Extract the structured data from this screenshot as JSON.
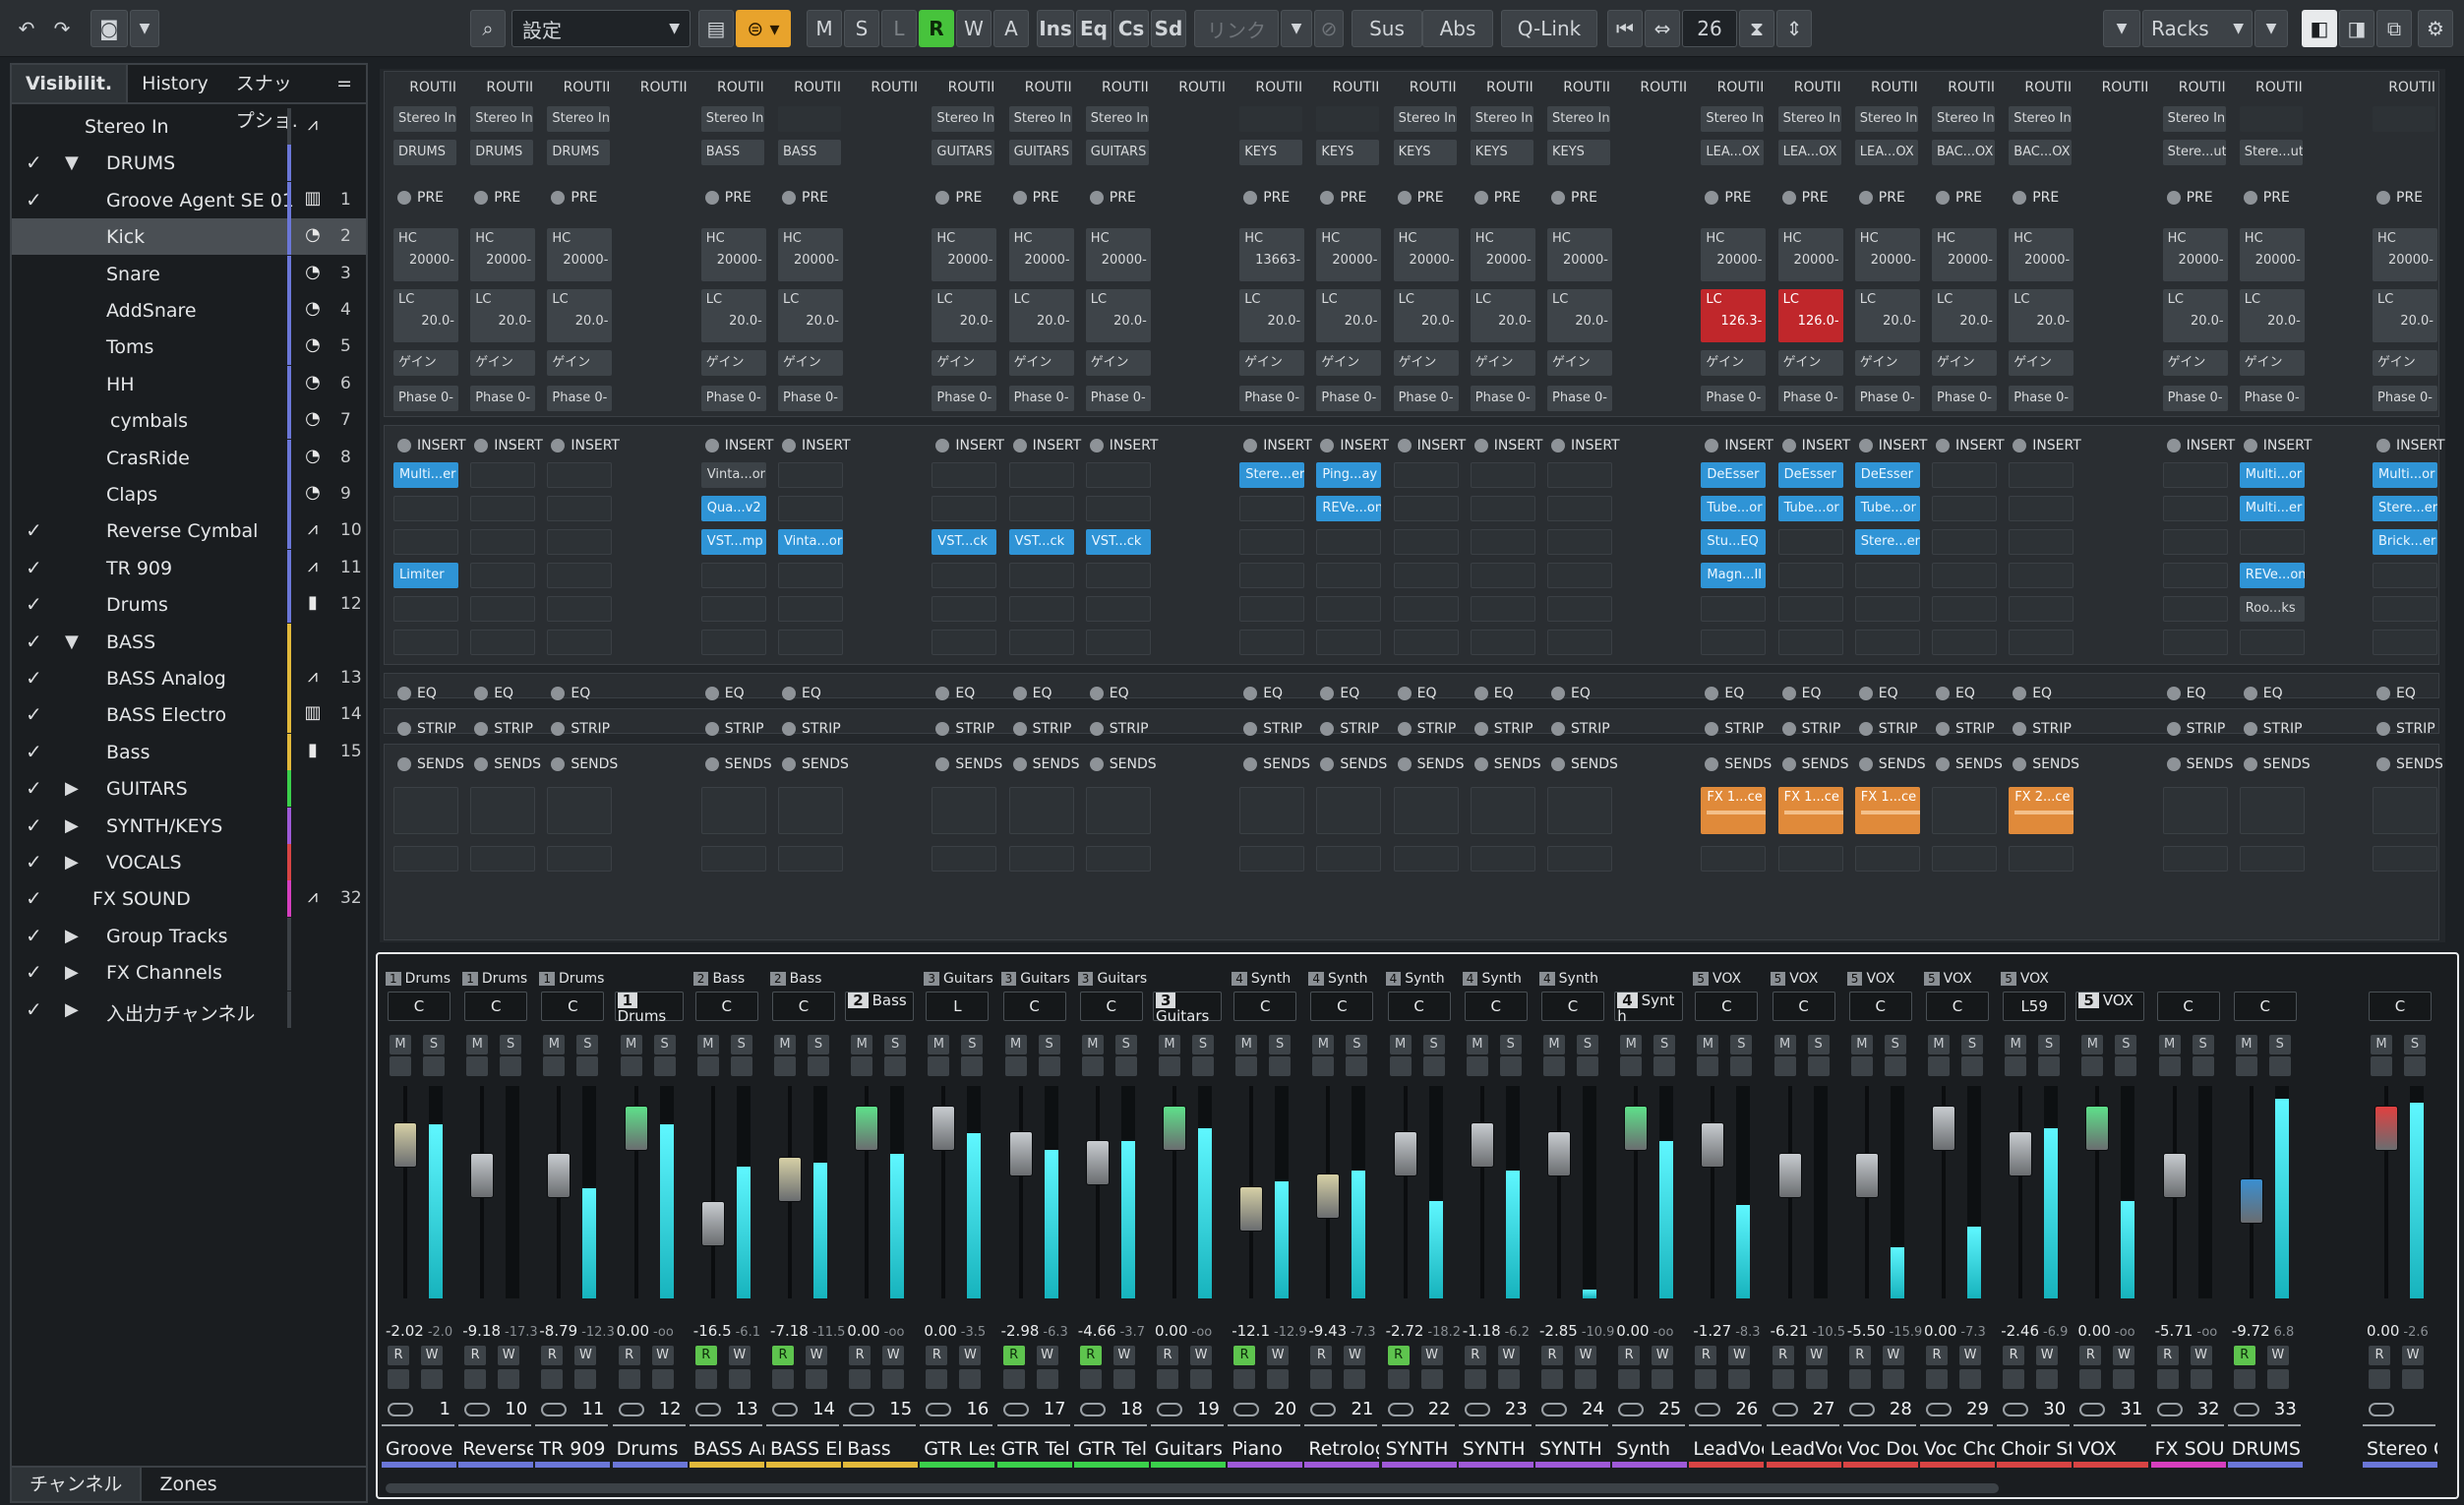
{
  "toolbar": {
    "preset_label": "設定",
    "btn_m": "M",
    "btn_s": "S",
    "btn_l": "L",
    "btn_r": "R",
    "btn_w": "W",
    "btn_a": "A",
    "btn_ins": "Ins",
    "btn_eq": "Eq",
    "btn_cs": "Cs",
    "btn_sd": "Sd",
    "link_label": "リンク",
    "sus": "Sus",
    "abs": "Abs",
    "qlink": "Q-Link",
    "channel_count": "26",
    "racks": "Racks"
  },
  "left": {
    "tabs": [
      "Visibilit.",
      "History",
      "スナップショ.",
      "="
    ],
    "bottom_tabs": [
      "チャンネル",
      "Zones"
    ],
    "tracks": [
      {
        "check": "",
        "arrow": "",
        "name": "Stereo In",
        "indent": 74,
        "icon": "waveform-icon",
        "glyph": "⩘",
        "num": "",
        "bar": "",
        "sel": false
      },
      {
        "check": "✓",
        "arrow": "▼",
        "name": "DRUMS",
        "indent": 96,
        "icon": "",
        "glyph": "",
        "num": "",
        "bar": "#6b77d8",
        "sel": false
      },
      {
        "check": "✓",
        "arrow": "",
        "name": "Groove Agent SE 01",
        "indent": 96,
        "icon": "keyboard-icon",
        "glyph": "▥",
        "num": "1",
        "bar": "#6b77d8",
        "sel": false
      },
      {
        "check": "",
        "arrow": "",
        "name": "Kick",
        "indent": 96,
        "icon": "knob-icon",
        "glyph": "◔",
        "num": "2",
        "bar": "#6b77d8",
        "sel": true
      },
      {
        "check": "",
        "arrow": "",
        "name": "Snare",
        "indent": 96,
        "icon": "knob-icon",
        "glyph": "◔",
        "num": "3",
        "bar": "#6b77d8",
        "sel": false
      },
      {
        "check": "",
        "arrow": "",
        "name": "AddSnare",
        "indent": 96,
        "icon": "knob-icon",
        "glyph": "◔",
        "num": "4",
        "bar": "#6b77d8",
        "sel": false
      },
      {
        "check": "",
        "arrow": "",
        "name": "Toms",
        "indent": 96,
        "icon": "knob-icon",
        "glyph": "◔",
        "num": "5",
        "bar": "#6b77d8",
        "sel": false
      },
      {
        "check": "",
        "arrow": "",
        "name": "HH",
        "indent": 96,
        "icon": "knob-icon",
        "glyph": "◔",
        "num": "6",
        "bar": "#6b77d8",
        "sel": false
      },
      {
        "check": "",
        "arrow": "",
        "name": "cymbals",
        "indent": 100,
        "icon": "knob-icon",
        "glyph": "◔",
        "num": "7",
        "bar": "#6b77d8",
        "sel": false
      },
      {
        "check": "",
        "arrow": "",
        "name": "CrasRide",
        "indent": 96,
        "icon": "knob-icon",
        "glyph": "◔",
        "num": "8",
        "bar": "#6b77d8",
        "sel": false
      },
      {
        "check": "",
        "arrow": "",
        "name": "Claps",
        "indent": 96,
        "icon": "knob-icon",
        "glyph": "◔",
        "num": "9",
        "bar": "#6b77d8",
        "sel": false
      },
      {
        "check": "✓",
        "arrow": "",
        "name": "Reverse Cymbal",
        "indent": 96,
        "icon": "waveform-icon",
        "glyph": "⩘",
        "num": "10",
        "bar": "#6b77d8",
        "sel": false
      },
      {
        "check": "✓",
        "arrow": "",
        "name": "TR 909",
        "indent": 96,
        "icon": "waveform-icon",
        "glyph": "⩘",
        "num": "11",
        "bar": "#6b77d8",
        "sel": false
      },
      {
        "check": "✓",
        "arrow": "",
        "name": "Drums",
        "indent": 96,
        "icon": "group-icon",
        "glyph": "▮",
        "num": "12",
        "bar": "#6b77d8",
        "sel": false
      },
      {
        "check": "✓",
        "arrow": "▼",
        "name": "BASS",
        "indent": 96,
        "icon": "",
        "glyph": "",
        "num": "",
        "bar": "#e2b93b",
        "sel": false
      },
      {
        "check": "✓",
        "arrow": "",
        "name": "BASS Analog",
        "indent": 96,
        "icon": "waveform-icon",
        "glyph": "⩘",
        "num": "13",
        "bar": "#e2b93b",
        "sel": false
      },
      {
        "check": "✓",
        "arrow": "",
        "name": "BASS Electro",
        "indent": 96,
        "icon": "keyboard-icon",
        "glyph": "▥",
        "num": "14",
        "bar": "#e2b93b",
        "sel": false
      },
      {
        "check": "✓",
        "arrow": "",
        "name": "Bass",
        "indent": 96,
        "icon": "group-icon",
        "glyph": "▮",
        "num": "15",
        "bar": "#e2b93b",
        "sel": false
      },
      {
        "check": "✓",
        "arrow": "▶",
        "name": "GUITARS",
        "indent": 96,
        "icon": "",
        "glyph": "",
        "num": "",
        "bar": "#3bd04b",
        "sel": false
      },
      {
        "check": "✓",
        "arrow": "▶",
        "name": "SYNTH/KEYS",
        "indent": 96,
        "icon": "",
        "glyph": "",
        "num": "",
        "bar": "#9f5ad8",
        "sel": false
      },
      {
        "check": "✓",
        "arrow": "▶",
        "name": "VOCALS",
        "indent": 96,
        "icon": "",
        "glyph": "",
        "num": "",
        "bar": "#d84444",
        "sel": false
      },
      {
        "check": "✓",
        "arrow": "",
        "name": "FX SOUND",
        "indent": 82,
        "icon": "waveform-icon",
        "glyph": "⩘",
        "num": "32",
        "bar": "#d63fbf",
        "sel": false
      },
      {
        "check": "✓",
        "arrow": "▶",
        "name": "Group Tracks",
        "indent": 96,
        "icon": "",
        "glyph": "",
        "num": "",
        "bar": "",
        "sel": false
      },
      {
        "check": "✓",
        "arrow": "▶",
        "name": "FX Channels",
        "indent": 96,
        "icon": "",
        "glyph": "",
        "num": "",
        "bar": "",
        "sel": false
      },
      {
        "check": "✓",
        "arrow": "▶",
        "name": "入出力チャンネル",
        "indent": 96,
        "icon": "",
        "glyph": "",
        "num": "",
        "bar": "",
        "sel": false
      }
    ]
  },
  "rack": {
    "routing_label": "ROUTII",
    "pre_label": "PRE",
    "insert_label": "INSERT",
    "eq_label": "EQ",
    "strip_label": "STRIP",
    "sends_label": "SENDS",
    "gain_label": "ゲイン",
    "phase_label": "Phase 0-",
    "hc_label": "HC",
    "lc_label": "LC"
  },
  "channels": [
    {
      "name": "Groove",
      "num": "1",
      "group": "Drums",
      "gnum": "1",
      "color": "#6b77d8",
      "in": "Stereo In",
      "out": "DRUMS",
      "hc": "20000-",
      "lc": "20.0-",
      "lcon": false,
      "ins": [
        "b:Multi...er",
        "",
        "",
        "b:Limiter",
        "",
        ""
      ],
      "send": "",
      "pan": "C",
      "db": "-2.02",
      "db2": "-2.0",
      "fader": 0.72,
      "meter": 0.82,
      "fcol": "#d6d0a6",
      "r": false,
      "w": false
    },
    {
      "name": "Reverse",
      "num": "10",
      "group": "Drums",
      "gnum": "1",
      "color": "#6b77d8",
      "in": "Stereo In",
      "out": "DRUMS",
      "hc": "20000-",
      "lc": "20.0-",
      "lcon": false,
      "ins": [
        "",
        "",
        "",
        "",
        "",
        ""
      ],
      "send": "",
      "pan": "C",
      "db": "-9.18",
      "db2": "-17.3",
      "fader": 0.58,
      "meter": 0.0,
      "fcol": "#c8ccd0",
      "r": false,
      "w": false
    },
    {
      "name": "TR 909",
      "num": "11",
      "group": "Drums",
      "gnum": "1",
      "color": "#6b77d8",
      "in": "Stereo In",
      "out": "DRUMS",
      "hc": "20000-",
      "lc": "20.0-",
      "lcon": false,
      "ins": [
        "",
        "",
        "",
        "",
        "",
        ""
      ],
      "send": "",
      "pan": "C",
      "db": "-8.79",
      "db2": "-12.3",
      "fader": 0.58,
      "meter": 0.52,
      "fcol": "#c8ccd0",
      "r": false,
      "w": false
    },
    {
      "name": "Drums",
      "num": "12",
      "group": "",
      "gnum": "1",
      "grpname": "Drums",
      "color": "#6b77d8",
      "in": "",
      "out": "",
      "hc": "",
      "lc": "",
      "lcon": false,
      "ins": null,
      "send": "",
      "pan": "",
      "db": "0.00",
      "db2": "-oo",
      "fader": 0.8,
      "meter": 0.82,
      "fcol": "#5ee08a",
      "r": false,
      "w": false,
      "isgroup": true
    },
    {
      "name": "BASS Ar",
      "num": "13",
      "group": "Bass",
      "gnum": "2",
      "color": "#e2b93b",
      "in": "Stereo In",
      "out": "BASS",
      "hc": "20000-",
      "lc": "20.0-",
      "lcon": false,
      "ins": [
        "g:Vinta...or",
        "b:Qua...v2",
        "b:VST...mp",
        "",
        "",
        ""
      ],
      "send": "",
      "pan": "C",
      "db": "-16.5",
      "db2": "-6.1",
      "fader": 0.35,
      "meter": 0.62,
      "fcol": "#c8ccd0",
      "r": true,
      "w": false
    },
    {
      "name": "BASS El",
      "num": "14",
      "group": "Bass",
      "gnum": "2",
      "color": "#e2b93b",
      "in": "",
      "out": "BASS",
      "hc": "20000-",
      "lc": "20.0-",
      "lcon": false,
      "ins": [
        "",
        "",
        "b:Vinta...or",
        "",
        "",
        ""
      ],
      "send": "",
      "pan": "C",
      "db": "-7.18",
      "db2": "-11.5",
      "fader": 0.56,
      "meter": 0.64,
      "fcol": "#d6d0a6",
      "r": true,
      "w": false
    },
    {
      "name": "Bass",
      "num": "15",
      "group": "",
      "gnum": "2",
      "grpname": "Bass",
      "color": "#e2b93b",
      "in": "",
      "out": "",
      "hc": "",
      "lc": "",
      "lcon": false,
      "ins": null,
      "send": "",
      "pan": "",
      "db": "0.00",
      "db2": "-oo",
      "fader": 0.8,
      "meter": 0.68,
      "fcol": "#5ee08a",
      "r": false,
      "w": false,
      "isgroup": true
    },
    {
      "name": "GTR Les",
      "num": "16",
      "group": "Guitars",
      "gnum": "3",
      "color": "#3bd04b",
      "in": "Stereo In",
      "out": "GUITARS",
      "hc": "20000-",
      "lc": "20.0-",
      "lcon": false,
      "ins": [
        "",
        "",
        "b:VST...ck",
        "",
        "",
        ""
      ],
      "send": "",
      "pan": "L",
      "db": "0.00",
      "db2": "-3.5",
      "fader": 0.8,
      "meter": 0.78,
      "fcol": "#c8ccd0",
      "r": false,
      "w": false
    },
    {
      "name": "GTR Tel",
      "num": "17",
      "group": "Guitars",
      "gnum": "3",
      "color": "#3bd04b",
      "in": "Stereo In",
      "out": "GUITARS",
      "hc": "20000-",
      "lc": "20.0-",
      "lcon": false,
      "ins": [
        "",
        "",
        "b:VST...ck",
        "",
        "",
        ""
      ],
      "send": "",
      "pan": "C",
      "db": "-2.98",
      "db2": "-6.3",
      "fader": 0.68,
      "meter": 0.7,
      "fcol": "#c8ccd0",
      "r": true,
      "w": false
    },
    {
      "name": "GTR Tel",
      "num": "18",
      "group": "Guitars",
      "gnum": "3",
      "color": "#3bd04b",
      "in": "Stereo In",
      "out": "GUITARS",
      "hc": "20000-",
      "lc": "20.0-",
      "lcon": false,
      "ins": [
        "",
        "",
        "b:VST...ck",
        "",
        "",
        ""
      ],
      "send": "",
      "pan": "C",
      "db": "-4.66",
      "db2": "-3.7",
      "fader": 0.64,
      "meter": 0.74,
      "fcol": "#c8ccd0",
      "r": true,
      "w": false
    },
    {
      "name": "Guitars",
      "num": "19",
      "group": "",
      "gnum": "3",
      "grpname": "Guitars",
      "color": "#3bd04b",
      "in": "",
      "out": "",
      "hc": "",
      "lc": "",
      "lcon": false,
      "ins": null,
      "send": "",
      "pan": "",
      "db": "0.00",
      "db2": "-oo",
      "fader": 0.8,
      "meter": 0.8,
      "fcol": "#5ee08a",
      "r": false,
      "w": false,
      "isgroup": true
    },
    {
      "name": "Piano",
      "num": "20",
      "group": "Synth",
      "gnum": "4",
      "color": "#9f5ad8",
      "in": "",
      "out": "KEYS",
      "hc": "13663-",
      "lc": "20.0-",
      "lcon": false,
      "ins": [
        "b:Stere...er",
        "",
        "",
        "",
        "",
        ""
      ],
      "send": "",
      "pan": "C",
      "db": "-12.1",
      "db2": "-12.9",
      "fader": 0.42,
      "meter": 0.55,
      "fcol": "#d6d0a6",
      "r": true,
      "w": false
    },
    {
      "name": "Retrolog",
      "num": "21",
      "group": "Synth",
      "gnum": "4",
      "color": "#9f5ad8",
      "in": "",
      "out": "KEYS",
      "hc": "20000-",
      "lc": "20.0-",
      "lcon": false,
      "ins": [
        "b:Ping...ay",
        "b:REVe...on",
        "",
        "",
        "",
        ""
      ],
      "send": "",
      "pan": "C",
      "db": "-9.43",
      "db2": "-7.3",
      "fader": 0.48,
      "meter": 0.6,
      "fcol": "#d6d0a6",
      "r": false,
      "w": false
    },
    {
      "name": "SYNTH",
      "num": "22",
      "group": "Synth",
      "gnum": "4",
      "color": "#9f5ad8",
      "in": "Stereo In",
      "out": "KEYS",
      "hc": "20000-",
      "lc": "20.0-",
      "lcon": false,
      "ins": [
        "",
        "",
        "",
        "",
        "",
        ""
      ],
      "send": "",
      "pan": "C",
      "db": "-2.72",
      "db2": "-18.2",
      "fader": 0.68,
      "meter": 0.46,
      "fcol": "#c8ccd0",
      "r": true,
      "w": false
    },
    {
      "name": "SYNTH",
      "num": "23",
      "group": "Synth",
      "gnum": "4",
      "color": "#9f5ad8",
      "in": "Stereo In",
      "out": "KEYS",
      "hc": "20000-",
      "lc": "20.0-",
      "lcon": false,
      "ins": [
        "",
        "",
        "",
        "",
        "",
        ""
      ],
      "send": "",
      "pan": "C",
      "db": "-1.18",
      "db2": "-6.2",
      "fader": 0.72,
      "meter": 0.6,
      "fcol": "#c8ccd0",
      "r": false,
      "w": false
    },
    {
      "name": "SYNTH",
      "num": "24",
      "group": "Synth",
      "gnum": "4",
      "color": "#9f5ad8",
      "in": "Stereo In",
      "out": "KEYS",
      "hc": "20000-",
      "lc": "20.0-",
      "lcon": false,
      "ins": [
        "",
        "",
        "",
        "",
        "",
        ""
      ],
      "send": "",
      "pan": "C",
      "db": "-2.85",
      "db2": "-10.9",
      "fader": 0.68,
      "meter": 0.04,
      "fcol": "#c8ccd0",
      "r": false,
      "w": false
    },
    {
      "name": "Synth",
      "num": "25",
      "group": "",
      "gnum": "4",
      "grpname": "Synt h",
      "color": "#9f5ad8",
      "in": "",
      "out": "",
      "hc": "",
      "lc": "",
      "lcon": false,
      "ins": null,
      "send": "",
      "pan": "",
      "db": "0.00",
      "db2": "-oo",
      "fader": 0.8,
      "meter": 0.74,
      "fcol": "#5ee08a",
      "r": false,
      "w": false,
      "isgroup": true
    },
    {
      "name": "LeadVoc",
      "num": "26",
      "group": "VOX",
      "gnum": "5",
      "color": "#d84444",
      "in": "Stereo In",
      "out": "LEA...OX",
      "hc": "20000-",
      "lc": "126.3-",
      "lcon": true,
      "ins": [
        "b:DeEsser",
        "b:Tube...or",
        "b:Stu...EQ",
        "b:Magn...II",
        "",
        ""
      ],
      "send": "FX 1...ce",
      "pan": "C",
      "db": "-1.27",
      "db2": "-8.3",
      "fader": 0.72,
      "meter": 0.44,
      "fcol": "#c8ccd0",
      "r": false,
      "w": false
    },
    {
      "name": "LeadVoc",
      "num": "27",
      "group": "VOX",
      "gnum": "5",
      "color": "#d84444",
      "in": "Stereo In",
      "out": "LEA...OX",
      "hc": "20000-",
      "lc": "126.0-",
      "lcon": true,
      "ins": [
        "b:DeEsser",
        "b:Tube...or",
        "",
        "",
        "",
        ""
      ],
      "send": "FX 1...ce",
      "pan": "C",
      "db": "-6.21",
      "db2": "-10.5",
      "fader": 0.58,
      "meter": 0.0,
      "fcol": "#c8ccd0",
      "r": false,
      "w": false
    },
    {
      "name": "Voc Dou",
      "num": "28",
      "group": "VOX",
      "gnum": "5",
      "color": "#d84444",
      "in": "Stereo In",
      "out": "LEA...OX",
      "hc": "20000-",
      "lc": "20.0-",
      "lcon": false,
      "ins": [
        "b:DeEsser",
        "b:Tube...or",
        "b:Stere...er",
        "",
        "",
        ""
      ],
      "send": "FX 1...ce",
      "pan": "C",
      "db": "-5.50",
      "db2": "-15.9",
      "fader": 0.58,
      "meter": 0.24,
      "fcol": "#c8ccd0",
      "r": false,
      "w": false
    },
    {
      "name": "Voc Chc",
      "num": "29",
      "group": "VOX",
      "gnum": "5",
      "color": "#d84444",
      "in": "Stereo In",
      "out": "BAC...OX",
      "hc": "20000-",
      "lc": "20.0-",
      "lcon": false,
      "ins": [
        "",
        "",
        "",
        "",
        "",
        ""
      ],
      "send": "",
      "pan": "C",
      "db": "0.00",
      "db2": "-7.3",
      "fader": 0.8,
      "meter": 0.34,
      "fcol": "#c8ccd0",
      "r": false,
      "w": false
    },
    {
      "name": "Choir St",
      "num": "30",
      "group": "VOX",
      "gnum": "5",
      "color": "#d84444",
      "in": "Stereo In",
      "out": "BAC...OX",
      "hc": "20000-",
      "lc": "20.0-",
      "lcon": false,
      "ins": [
        "",
        "",
        "",
        "",
        "",
        ""
      ],
      "send": "FX 2...ce",
      "pan": "L59",
      "db": "-2.46",
      "db2": "-6.9",
      "fader": 0.68,
      "meter": 0.8,
      "fcol": "#c8ccd0",
      "r": false,
      "w": false
    },
    {
      "name": "VOX",
      "num": "31",
      "group": "",
      "gnum": "5",
      "grpname": "VOX",
      "color": "#d84444",
      "in": "",
      "out": "",
      "hc": "",
      "lc": "",
      "lcon": false,
      "ins": null,
      "send": "",
      "pan": "",
      "db": "0.00",
      "db2": "-oo",
      "fader": 0.8,
      "meter": 0.46,
      "fcol": "#5ee08a",
      "r": false,
      "w": false,
      "isgroup": true
    },
    {
      "name": "FX SOU",
      "num": "32",
      "group": "",
      "gnum": "",
      "color": "#d63fbf",
      "in": "Stereo In",
      "out": "Stere...ut",
      "hc": "20000-",
      "lc": "20.0-",
      "lcon": false,
      "ins": [
        "",
        "",
        "",
        "",
        "",
        ""
      ],
      "send": "",
      "pan": "C",
      "db": "-5.71",
      "db2": "-oo",
      "fader": 0.58,
      "meter": 0.0,
      "fcol": "#c8ccd0",
      "r": false,
      "w": false
    },
    {
      "name": "DRUMS",
      "num": "33",
      "group": "",
      "gnum": "",
      "color": "#6b77d8",
      "in": "",
      "out": "Stere...ut",
      "hc": "20000-",
      "lc": "20.0-",
      "lcon": false,
      "ins": [
        "b:Multi...or",
        "b:Multi...er",
        "",
        "b:REVe...on",
        "g:Roo...ks",
        ""
      ],
      "send": "",
      "pan": "C",
      "db": "-9.72",
      "db2": "6.8",
      "fader": 0.46,
      "meter": 0.94,
      "fcol": "#3a8fd0",
      "r": true,
      "w": false
    },
    {
      "name": "Stereo O",
      "num": "",
      "group": "",
      "gnum": "",
      "color": "#6b77d8",
      "in": "",
      "out": "",
      "hc": "20000-",
      "lc": "20.0-",
      "lcon": false,
      "ins": [
        "b:Multi...or",
        "b:Stere...er",
        "b:Brick...er",
        "",
        "",
        ""
      ],
      "send": "",
      "pan": "C",
      "db": "0.00",
      "db2": "-2.6",
      "fader": 0.8,
      "meter": 0.92,
      "fcol": "#e04040",
      "r": false,
      "w": false,
      "master": true
    }
  ]
}
